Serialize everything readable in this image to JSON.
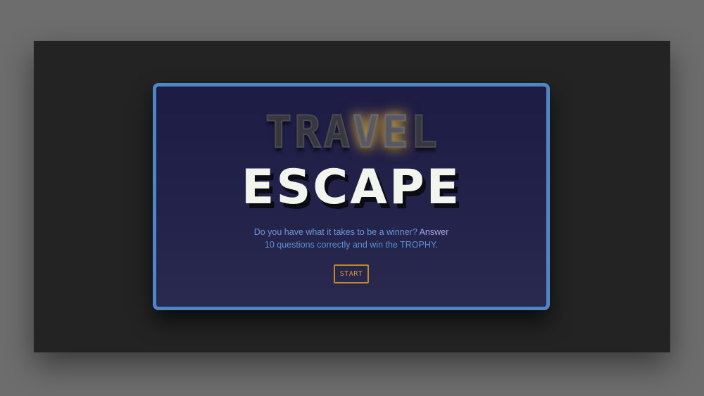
{
  "title_top": {
    "letters": [
      "T",
      "R",
      "A",
      "V",
      "E",
      "L"
    ],
    "lit_letters": [
      "V",
      "E"
    ]
  },
  "title_main": "ESCAPE",
  "description": {
    "line1_part1": "Do you have what it takes to be a winner? ",
    "line1_part2": "Answer",
    "line2": "10 questions correctly and win the TROPHY."
  },
  "start_button": {
    "label": "START"
  },
  "colors": {
    "card_border": "#4f86c9",
    "button_accent": "#c28b22",
    "glow": "#c9a13a"
  }
}
